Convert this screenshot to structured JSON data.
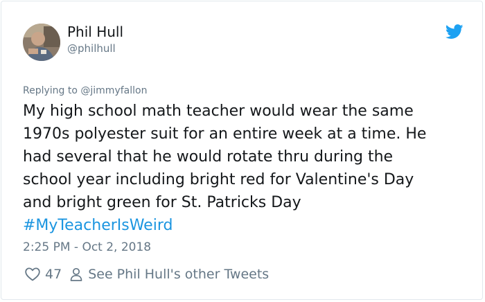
{
  "author": {
    "name": "Phil Hull",
    "handle": "@philhull"
  },
  "icons": {
    "brand": "twitter-bird-icon",
    "like": "heart-icon",
    "profile": "person-icon"
  },
  "colors": {
    "link": "#1b95e0",
    "brand": "#1da1f2",
    "muted": "#657786",
    "text": "#14171a"
  },
  "reply": {
    "prefix": "Replying to",
    "mention": "@jimmyfallon"
  },
  "tweet": {
    "lines": [
      "My high school math teacher would wear the same",
      "1970s polyester suit for an entire week at a time. He",
      "had several that he would rotate thru during the",
      "school year including bright red for Valentine's Day",
      "and bright green for St. Patricks Day"
    ],
    "hashtag": "#MyTeacherIsWeird"
  },
  "timestamp": "2:25 PM - Oct 2, 2018",
  "actions": {
    "like_count": "47",
    "other_tweets_label": "See Phil Hull's other Tweets"
  }
}
